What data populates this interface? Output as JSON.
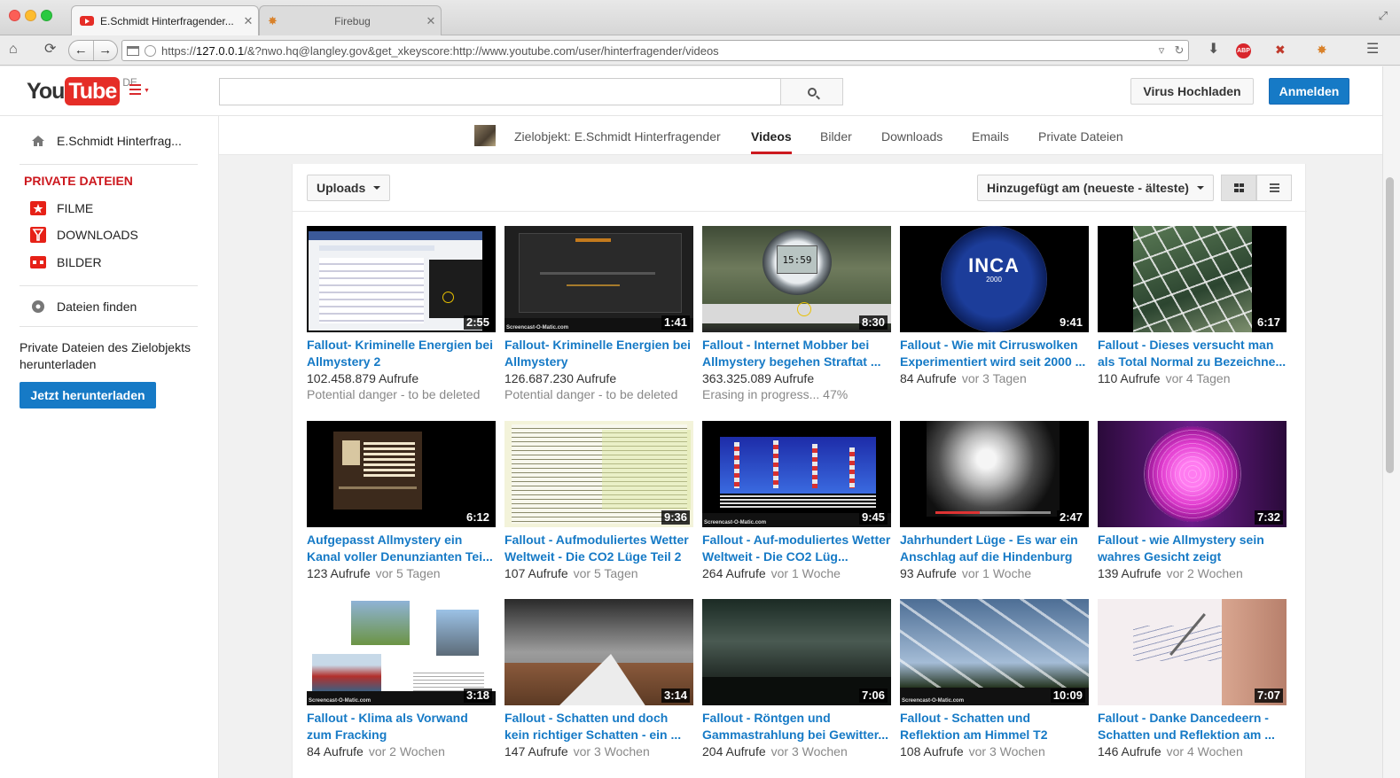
{
  "browser": {
    "tabs": [
      {
        "label": "E.Schmidt Hinterfragender...",
        "active": true
      },
      {
        "label": "Firebug",
        "active": false
      }
    ],
    "url_prefix": "https://",
    "url_host": "127.0.0.1",
    "url_rest": "/&?nwo.hq@langley.gov&get_xkeyscore:http://www.youtube.com/user/hinterfragender/videos"
  },
  "masthead": {
    "logo_you": "You",
    "logo_tube": "Tube",
    "logo_region": "DE",
    "upload_label": "Virus Hochladen",
    "signin_label": "Anmelden",
    "search_placeholder": ""
  },
  "sidebar": {
    "home_label": "E.Schmidt Hinterfrag...",
    "section_title": "PRIVATE DATEIEN",
    "items": [
      {
        "label": "FILME",
        "icon": "film-icon"
      },
      {
        "label": "DOWNLOADS",
        "icon": "download-icon"
      },
      {
        "label": "BILDER",
        "icon": "image-icon"
      }
    ],
    "find_label": "Dateien finden",
    "download_text": "Private Dateien des Zielobjekts herunterladen",
    "download_button": "Jetzt herunterladen"
  },
  "channel_nav": {
    "target": "Zielobjekt: E.Schmidt Hinterfragender",
    "tabs": [
      "Videos",
      "Bilder",
      "Downloads",
      "Emails",
      "Private Dateien"
    ],
    "active_tab": "Videos"
  },
  "toolbar": {
    "uploads_label": "Uploads",
    "sort_label": "Hinzugefügt am (neueste - älteste)"
  },
  "videos": [
    {
      "title": "Fallout- Kriminelle Energien bei Allmystery 2",
      "duration": "2:55",
      "views": "102.458.879 Aufrufe",
      "age": "",
      "status": "Potential danger - to be deleted"
    },
    {
      "title": "Fallout- Kriminelle Energien bei Allmystery",
      "duration": "1:41",
      "views": "126.687.230 Aufrufe",
      "age": "",
      "status": "Potential danger - to be deleted"
    },
    {
      "title": "Fallout - Internet Mobber bei Allmystery begehen Straftat ...",
      "duration": "8:30",
      "views": "363.325.089 Aufrufe",
      "age": "",
      "status": "Erasing in progress... 47%"
    },
    {
      "title": "Fallout - Wie mit Cirruswolken Experimentiert wird seit 2000 ...",
      "duration": "9:41",
      "views": "84 Aufrufe",
      "age": "vor 3 Tagen",
      "status": ""
    },
    {
      "title": "Fallout - Dieses versucht man als Total Normal zu Bezeichne...",
      "duration": "6:17",
      "views": "110 Aufrufe",
      "age": "vor 4 Tagen",
      "status": ""
    },
    {
      "title": "Aufgepasst Allmystery ein Kanal voller Denunzianten Tei...",
      "duration": "6:12",
      "views": "123 Aufrufe",
      "age": "vor 5 Tagen",
      "status": ""
    },
    {
      "title": "Fallout - Aufmoduliertes Wetter Weltweit - Die CO2 Lüge Teil 2",
      "duration": "9:36",
      "views": "107 Aufrufe",
      "age": "vor 5 Tagen",
      "status": ""
    },
    {
      "title": "Fallout - Auf-moduliertes Wetter Weltweit - Die CO2 Lüg...",
      "duration": "9:45",
      "views": "264 Aufrufe",
      "age": "vor 1 Woche",
      "status": ""
    },
    {
      "title": "Jahrhundert Lüge - Es war ein Anschlag auf die Hindenburg",
      "duration": "2:47",
      "views": "93 Aufrufe",
      "age": "vor 1 Woche",
      "status": ""
    },
    {
      "title": "Fallout - wie Allmystery sein wahres Gesicht zeigt",
      "duration": "7:32",
      "views": "139 Aufrufe",
      "age": "vor 2 Wochen",
      "status": ""
    },
    {
      "title": "Fallout - Klima als Vorwand zum Fracking",
      "duration": "3:18",
      "views": "84 Aufrufe",
      "age": "vor 2 Wochen",
      "status": ""
    },
    {
      "title": "Fallout - Schatten und doch kein richtiger Schatten - ein ...",
      "duration": "3:14",
      "views": "147 Aufrufe",
      "age": "vor 3 Wochen",
      "status": ""
    },
    {
      "title": "Fallout - Röntgen und Gammastrahlung bei Gewitter...",
      "duration": "7:06",
      "views": "204 Aufrufe",
      "age": "vor 3 Wochen",
      "status": ""
    },
    {
      "title": "Fallout - Schatten und Reflektion am Himmel T2",
      "duration": "10:09",
      "views": "108 Aufrufe",
      "age": "vor 3 Wochen",
      "status": ""
    },
    {
      "title": "Fallout - Danke Dancedeern - Schatten und Reflektion am ...",
      "duration": "7:07",
      "views": "146 Aufrufe",
      "age": "vor 4 Wochen",
      "status": ""
    }
  ],
  "thumb_texts": {
    "inca": "INCA",
    "inca_year": "2000",
    "watch_time": "15:59",
    "watermark": "Screencast-O-Matic.com"
  },
  "colors": {
    "accent_blue": "#167ac6",
    "youtube_red": "#e52d27",
    "section_red": "#cc181e"
  }
}
